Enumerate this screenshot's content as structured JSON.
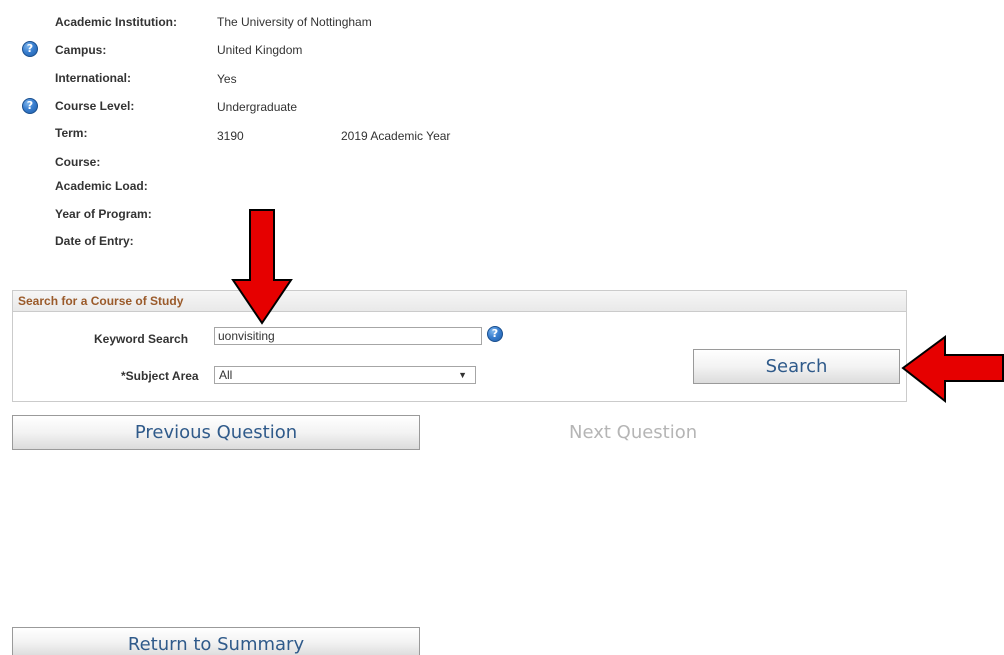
{
  "info": {
    "institution_label": "Academic Institution:",
    "institution_value": "The University of Nottingham",
    "campus_label": "Campus:",
    "campus_value": "United Kingdom",
    "international_label": "International:",
    "international_value": "Yes",
    "course_level_label": "Course Level:",
    "course_level_value": "Undergraduate",
    "term_label": "Term:",
    "term_code": "3190",
    "term_desc": "2019 Academic Year",
    "course_label": "Course:",
    "academic_load_label": "Academic Load:",
    "year_of_program_label": "Year of Program:",
    "date_of_entry_label": "Date of Entry:",
    "help_glyph": "?"
  },
  "search": {
    "section_title": "Search for a Course of Study",
    "keyword_label": "Keyword Search",
    "keyword_value": "uonvisiting",
    "subject_label": "*Subject Area",
    "subject_selected": "All",
    "search_button": "Search"
  },
  "nav": {
    "previous_button": "Previous Question",
    "next_link": "Next Question",
    "return_button": "Return to Summary"
  },
  "annotations": {
    "arrow_color": "#e60000"
  },
  "icons": {
    "help": "help-icon",
    "dropdown": "chevron-down-icon"
  }
}
